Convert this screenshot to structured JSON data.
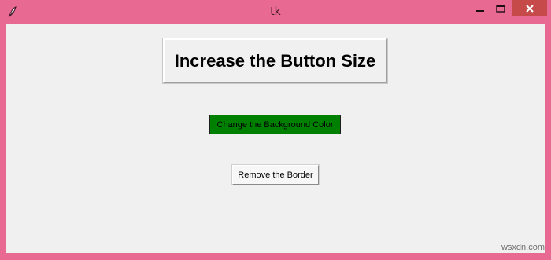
{
  "window": {
    "title": "tk",
    "frame_color": "#e86a92",
    "close_color": "#c74a4a"
  },
  "titlebar": {
    "app_icon": "feather-icon",
    "minimize_icon": "minimize-icon",
    "maximize_icon": "maximize-icon",
    "close_icon": "close-icon"
  },
  "buttons": {
    "increase_size_label": "Increase the Button Size",
    "change_bg_label": "Change the Background Color",
    "change_bg_color": "#008000",
    "remove_border_label": "Remove the Border"
  },
  "watermark": {
    "text": "wsxdn.com"
  }
}
